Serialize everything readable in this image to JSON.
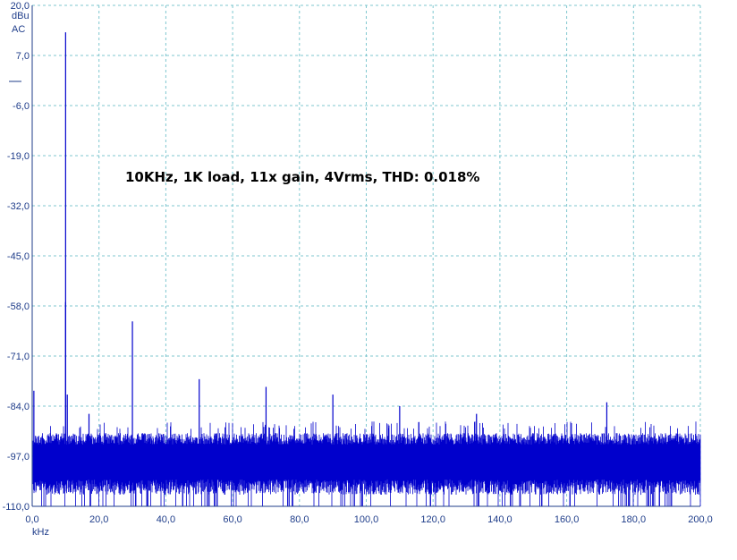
{
  "chart_data": {
    "type": "line",
    "title": "10KHz, 1K load, 11x gain, 4Vrms, THD: 0.018%",
    "xlabel": "kHz",
    "ylabel": "dBu",
    "y_mode": "AC",
    "xlim": [
      0,
      200
    ],
    "ylim": [
      -110,
      20
    ],
    "x_ticks": [
      "0,0",
      "20,0",
      "40,0",
      "60,0",
      "80,0",
      "100,0",
      "120,0",
      "140,0",
      "160,0",
      "180,0",
      "200,0"
    ],
    "y_ticks": [
      "20,0",
      "7,0",
      "-6,0",
      "-19,0",
      "-32,0",
      "-45,0",
      "-58,0",
      "-71,0",
      "-84,0",
      "-97,0",
      "-110,0"
    ],
    "grid": true,
    "series": [
      {
        "color": "#0000cc",
        "noise_floor_db": [
          -110,
          -88
        ],
        "peaks": [
          {
            "x": 0.5,
            "y": -80
          },
          {
            "x": 10.0,
            "y": 13
          },
          {
            "x": 10.0,
            "y": -57
          },
          {
            "x": 10.5,
            "y": -81
          },
          {
            "x": 30.0,
            "y": -62
          },
          {
            "x": 50.0,
            "y": -77
          },
          {
            "x": 70.0,
            "y": -79
          },
          {
            "x": 90.0,
            "y": -81
          },
          {
            "x": 110.0,
            "y": -84
          },
          {
            "x": 172.0,
            "y": -83
          },
          {
            "x": 17.0,
            "y": -86
          },
          {
            "x": 133.0,
            "y": -86
          }
        ]
      }
    ]
  },
  "colors": {
    "axis": "#1f3d8a",
    "grid": "#7fc7cf",
    "trace": "#0000cc",
    "background": "#ffffff"
  }
}
